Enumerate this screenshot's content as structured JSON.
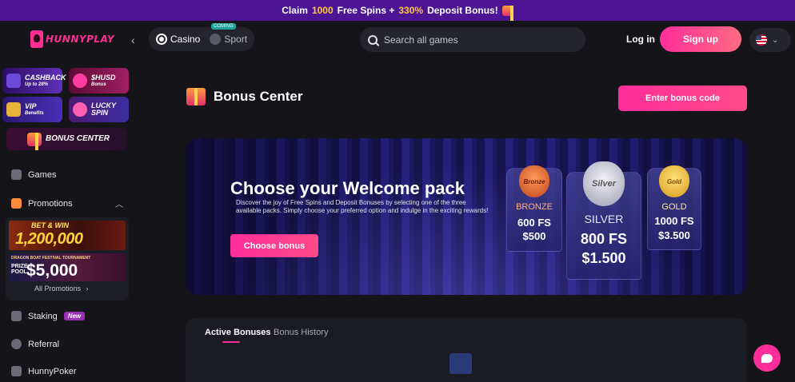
{
  "promo_bar": {
    "prefix": "Claim",
    "spins_num": "1000",
    "spins_text": "Free Spins +",
    "pct": "330%",
    "suffix": "Deposit Bonus!"
  },
  "header": {
    "logo": "HUNNYPLAY",
    "modes": [
      {
        "label": "Casino"
      },
      {
        "label": "Sport"
      }
    ],
    "coming_soon": "COMING",
    "search_placeholder": "Search all games",
    "login_label": "Log in",
    "signup_label": "Sign up"
  },
  "sidebar": {
    "tiles": {
      "cashback": {
        "title": "CASHBACK",
        "sub": "Up to 28%"
      },
      "husd": {
        "title": "$HUSD",
        "sub": "Bonus"
      },
      "vip": {
        "title": "VIP",
        "sub": "Benefits"
      },
      "lucky": {
        "title": "LUCKY",
        "sub": "SPIN"
      },
      "bonus_center": {
        "title": "BONUS CENTER"
      }
    },
    "nav": {
      "games": "Games",
      "promotions": "Promotions",
      "staking": "Staking",
      "new_badge": "New",
      "referral": "Referral",
      "hunnypoker": "HunnyPoker"
    },
    "promo_banners": {
      "b1_top": "BET & WIN",
      "b1_amount": "1,200,000",
      "b2_title": "DRAGON BOAT FESTIVAL TOURNAMENT",
      "b2_prize": "PRIZE POOL",
      "b2_amount": "$5,000"
    },
    "all_promotions": "All Promotions"
  },
  "main": {
    "title": "Bonus Center",
    "enter_code_label": "Enter bonus code",
    "hero": {
      "title": "Choose your Welcome pack",
      "description": "Discover the joy of Free Spins and Deposit Bonuses by selecting one of the three available packs. Simply choose your preferred option and indulge in the exciting rewards!",
      "button": "Choose bonus",
      "packs": [
        {
          "badge": "Bronze",
          "tier": "BRONZE",
          "fs": "600 FS",
          "cash": "$500"
        },
        {
          "badge": "Silver",
          "tier": "SILVER",
          "fs": "800 FS",
          "cash": "$1.500"
        },
        {
          "badge": "Gold",
          "tier": "GOLD",
          "fs": "1000 FS",
          "cash": "$3.500"
        }
      ]
    },
    "tabs": [
      {
        "label": "Active Bonuses"
      },
      {
        "label": "Bonus History"
      }
    ]
  },
  "colors": {
    "accent": "#ff2e9a",
    "promo_bar_bg": "#4b1594",
    "highlight": "#ffc83d",
    "page_bg": "#141419"
  },
  "icons": [
    "gift-icon",
    "search-icon",
    "chevron-left-icon",
    "chevron-down-icon",
    "flag-us-icon",
    "chat-icon"
  ]
}
